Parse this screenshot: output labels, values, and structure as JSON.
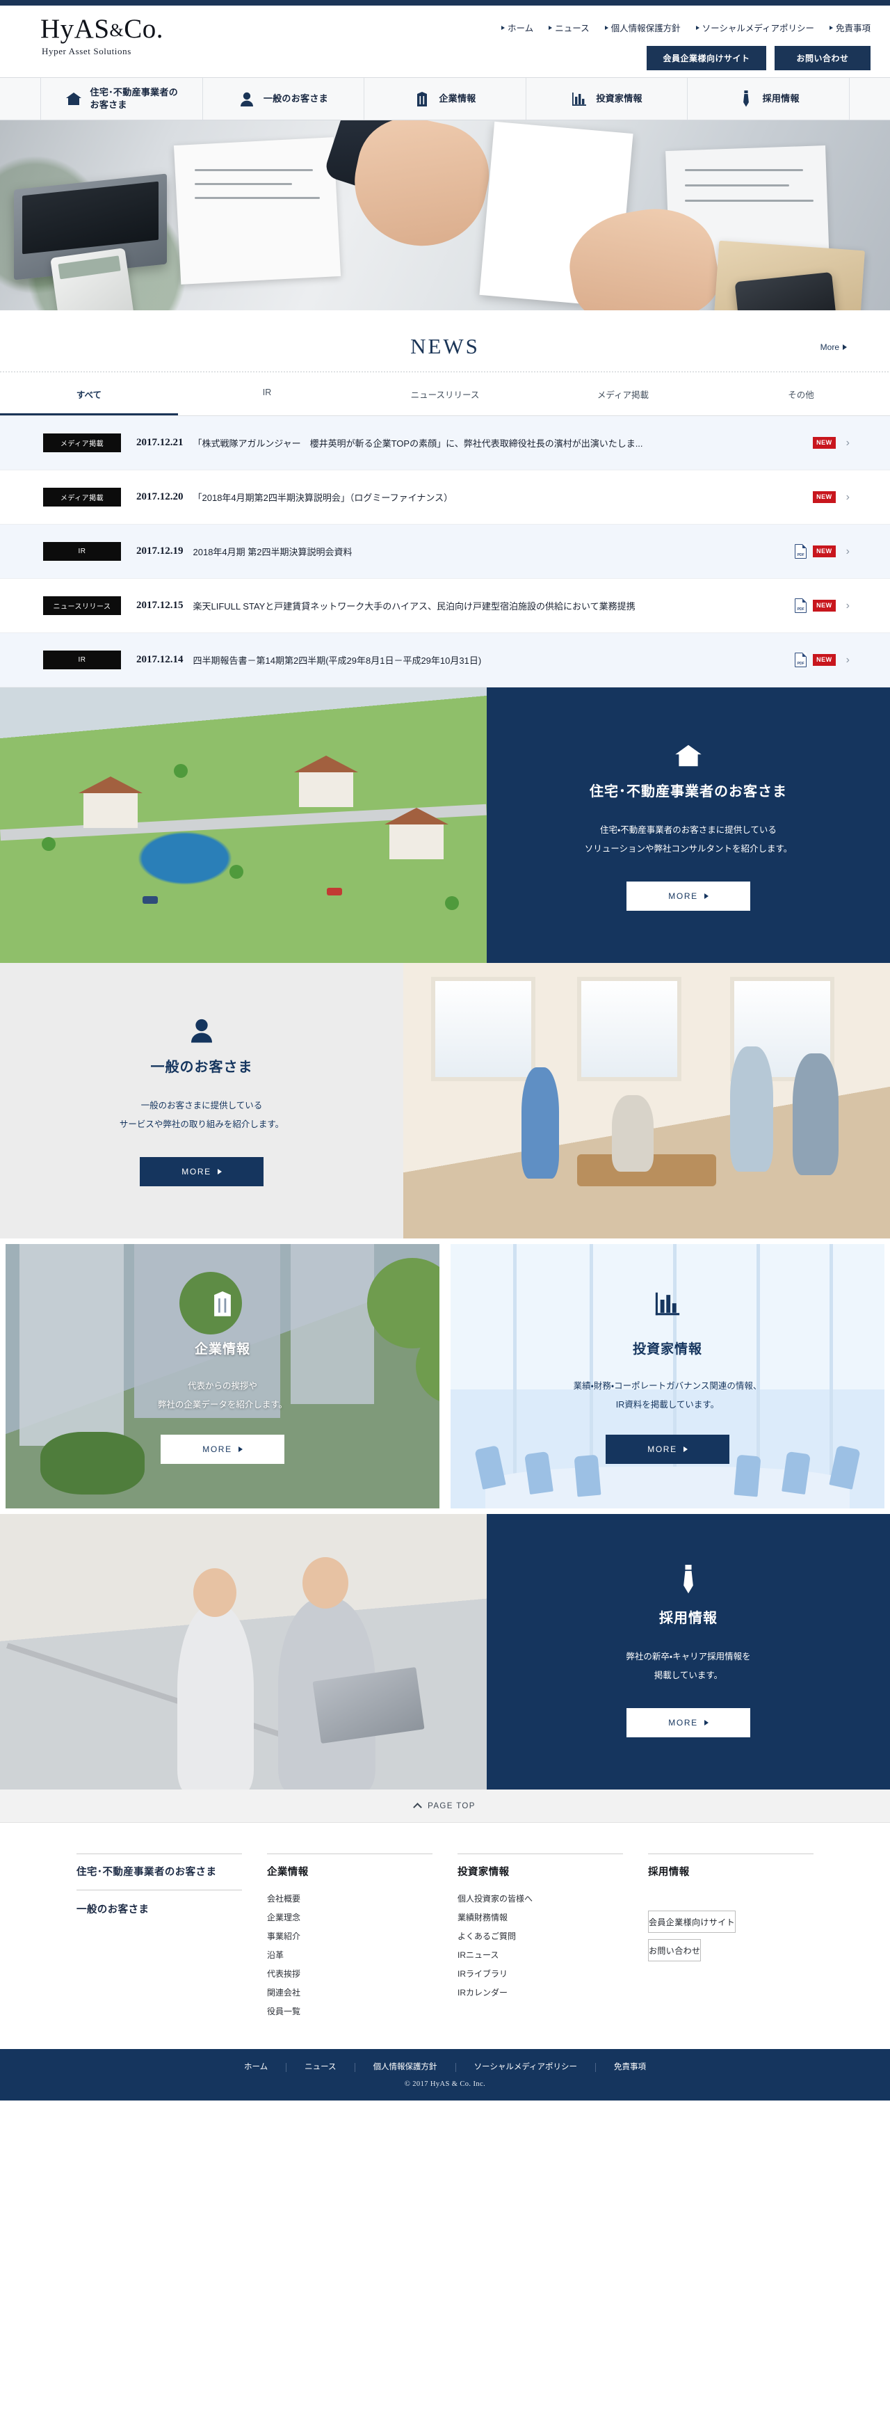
{
  "brand": {
    "name": "HyAS&Co.",
    "name_part1": "HyAS",
    "name_amp": "&",
    "name_part2": "Co.",
    "tagline": "Hyper Asset Solutions"
  },
  "colors": {
    "navy": "#15355e",
    "topstrip": "#1b3557",
    "badge_black": "#0c0c0c",
    "new_red": "#c8161d",
    "row_alt": "#f2f6fc"
  },
  "utility_nav": [
    {
      "label": "ホーム"
    },
    {
      "label": "ニュース"
    },
    {
      "label": "個人情報保護方針"
    },
    {
      "label": "ソーシャルメディアポリシー"
    },
    {
      "label": "免責事項"
    }
  ],
  "utility_buttons": [
    {
      "label": "会員企業様向けサイト"
    },
    {
      "label": "お問い合わせ"
    }
  ],
  "main_nav": [
    {
      "label_line1": "住宅･不動産事業者の",
      "label_line2": "お客さま",
      "icon": "house-icon"
    },
    {
      "label_line1": "一般のお客さま",
      "label_line2": "",
      "icon": "person-icon"
    },
    {
      "label_line1": "企業情報",
      "label_line2": "",
      "icon": "building-icon"
    },
    {
      "label_line1": "投資家情報",
      "label_line2": "",
      "icon": "bar-chart-icon"
    },
    {
      "label_line1": "採用情報",
      "label_line2": "",
      "icon": "necktie-icon"
    }
  ],
  "news": {
    "heading": "NEWS",
    "more_label": "More",
    "tabs": [
      {
        "label": "すべて",
        "active": true
      },
      {
        "label": "IR",
        "active": false
      },
      {
        "label": "ニュースリリース",
        "active": false
      },
      {
        "label": "メディア掲載",
        "active": false
      },
      {
        "label": "その他",
        "active": false
      }
    ],
    "items": [
      {
        "category": "メディア掲載",
        "date": "2017.12.21",
        "title": "「株式戦隊アガルンジャー　櫻井英明が斬る企業TOPの素顔」に、弊社代表取締役社長の濱村が出演いたしま...",
        "has_pdf": false,
        "is_new": true
      },
      {
        "category": "メディア掲載",
        "date": "2017.12.20",
        "title": "「2018年4月期第2四半期決算説明会」（ログミーファイナンス）",
        "has_pdf": false,
        "is_new": true
      },
      {
        "category": "IR",
        "date": "2017.12.19",
        "title": "2018年4月期 第2四半期決算説明会資料",
        "has_pdf": true,
        "is_new": true
      },
      {
        "category": "ニュースリリース",
        "date": "2017.12.15",
        "title": "楽天LIFULL STAYと戸建賃貸ネットワーク大手のハイアス、民泊向け戸建型宿泊施設の供給において業務提携",
        "has_pdf": true,
        "is_new": true
      },
      {
        "category": "IR",
        "date": "2017.12.14",
        "title": "四半期報告書－第14期第2四半期(平成29年8月1日－平成29年10月31日)",
        "has_pdf": true,
        "is_new": true
      }
    ]
  },
  "promos": [
    {
      "key": "business",
      "icon": "house-icon",
      "heading": "住宅･不動産事業者のお客さま",
      "body_line1": "住宅・不動産事業者のお客さまに提供している",
      "body_line2": "ソリューションや弊社コンサルタントを紹介します。",
      "button_label": "MORE"
    },
    {
      "key": "general",
      "icon": "person-icon",
      "heading": "一般のお客さま",
      "body_line1": "一般のお客さまに提供している",
      "body_line2": "サービスや弊社の取り組みを紹介します。",
      "button_label": "MORE"
    },
    {
      "key": "corporate",
      "icon": "building-icon",
      "heading": "企業情報",
      "body_line1": "代表からの挨拶や",
      "body_line2": "弊社の企業データを紹介します。",
      "button_label": "MORE"
    },
    {
      "key": "investor",
      "icon": "bar-chart-icon",
      "heading": "投資家情報",
      "body_line1": "業績・財務・コーポレートガバナンス関連の情報、",
      "body_line2": "IR資料を掲載しています。",
      "button_label": "MORE"
    },
    {
      "key": "recruit",
      "icon": "necktie-icon",
      "heading": "採用情報",
      "body_line1": "弊社の新卒・キャリア採用情報を",
      "body_line2": "掲載しています。",
      "button_label": "MORE"
    }
  ],
  "pagetop": {
    "label": "PAGE TOP"
  },
  "footer": {
    "columns": [
      {
        "heading": "住宅･不動産事業者のお客さま",
        "heading2": "一般のお客さま",
        "links": []
      },
      {
        "heading": "企業情報",
        "links": [
          {
            "label": "会社概要"
          },
          {
            "label": "企業理念"
          },
          {
            "label": "事業紹介"
          },
          {
            "label": "沿革"
          },
          {
            "label": "代表挨拶"
          },
          {
            "label": "関連会社"
          },
          {
            "label": "役員一覧"
          }
        ]
      },
      {
        "heading": "投資家情報",
        "links": [
          {
            "label": "個人投資家の皆様へ"
          },
          {
            "label": "業績財務情報"
          },
          {
            "label": "よくあるご質問"
          },
          {
            "label": "IRニュース"
          },
          {
            "label": "IRライブラリ"
          },
          {
            "label": "IRカレンダー"
          }
        ]
      },
      {
        "heading": "採用情報",
        "links": [],
        "buttons": [
          {
            "label": "会員企業様向けサイト"
          },
          {
            "label": "お問い合わせ"
          }
        ]
      }
    ],
    "bottom_links": [
      {
        "label": "ホーム"
      },
      {
        "label": "ニュース"
      },
      {
        "label": "個人情報保護方針"
      },
      {
        "label": "ソーシャルメディアポリシー"
      },
      {
        "label": "免責事項"
      }
    ],
    "copyright": "© 2017 HyAS & Co. Inc."
  }
}
